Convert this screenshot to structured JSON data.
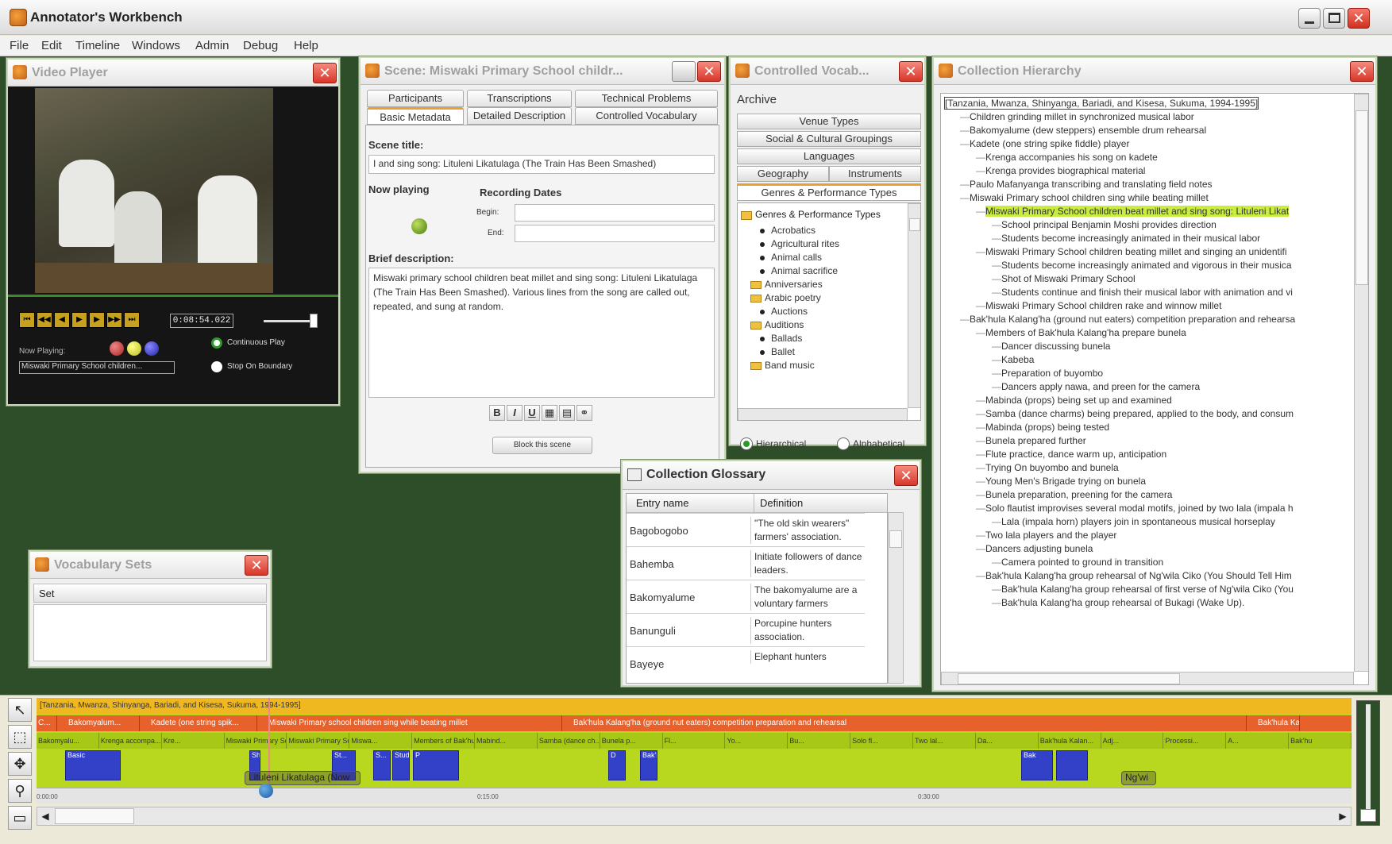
{
  "window": {
    "title": "Annotator's Workbench"
  },
  "menu": [
    "File",
    "Edit",
    "Timeline",
    "Windows",
    "Admin",
    "Debug",
    "Help"
  ],
  "video_player": {
    "title": "Video Player",
    "timecode": "0:08:54.022",
    "now_playing_label": "Now Playing:",
    "now_playing_value": "Miswaki Primary School children...",
    "continuous_play": "Continuous Play",
    "stop_on_boundary": "Stop On Boundary"
  },
  "scene": {
    "title": "Scene:  Miswaki Primary School childr...",
    "tabs_row1": [
      "Participants",
      "Transcriptions",
      "Technical Problems"
    ],
    "tabs_row2": [
      "Basic Metadata",
      "Detailed Description",
      "Controlled Vocabulary"
    ],
    "scene_title_label": "Scene title:",
    "scene_title_value": "I and sing song: Lituleni Likatulaga (The Train Has Been Smashed)",
    "now_playing_label": "Now playing",
    "recording_dates_label": "Recording Dates",
    "begin_label": "Begin:",
    "end_label": "End:",
    "brief_description_label": "Brief description:",
    "brief_description_text": "Miswaki primary school children beat millet and sing song: Lituleni Likatulaga (The Train Has Been Smashed). Various lines from the song are called out, repeated, and sung at random.",
    "format_buttons": [
      "B",
      "I",
      "U"
    ],
    "block_button": "Block this scene"
  },
  "controlled_vocab": {
    "title": "Controlled Vocab...",
    "archive": "Archive",
    "buttons": [
      "Venue Types",
      "Social & Cultural Groupings",
      "Languages",
      "Geography",
      "Instruments",
      "Genres & Performance Types"
    ],
    "tree_root": "Genres & Performance Types",
    "tree_items": [
      {
        "label": "Acrobatics",
        "folder": false
      },
      {
        "label": "Agricultural rites",
        "folder": false
      },
      {
        "label": "Animal calls",
        "folder": false
      },
      {
        "label": "Animal sacrifice",
        "folder": false
      },
      {
        "label": "Anniversaries",
        "folder": true
      },
      {
        "label": "Arabic poetry",
        "folder": true
      },
      {
        "label": "Auctions",
        "folder": false
      },
      {
        "label": "Auditions",
        "folder": true
      },
      {
        "label": "Ballads",
        "folder": false
      },
      {
        "label": "Ballet",
        "folder": false
      },
      {
        "label": "Band music",
        "folder": true
      }
    ],
    "radio_hierarchical": "Hierarchical",
    "radio_alphabetical": "Alphabetical"
  },
  "collection_hierarchy": {
    "title": "Collection Hierarchy",
    "items": [
      {
        "indent": 0,
        "text": "[Tanzania, Mwanza, Shinyanga, Bariadi, and Kisesa, Sukuma, 1994-1995]",
        "hl": false
      },
      {
        "indent": 1,
        "text": "Children grinding millet in synchronized musical labor",
        "hl": false
      },
      {
        "indent": 1,
        "text": "Bakomyalume (dew steppers) ensemble drum rehearsal",
        "hl": false
      },
      {
        "indent": 1,
        "text": "Kadete (one string spike fiddle) player",
        "hl": false
      },
      {
        "indent": 2,
        "text": "Krenga accompanies his song on kadete",
        "hl": false
      },
      {
        "indent": 2,
        "text": "Krenga provides biographical material",
        "hl": false
      },
      {
        "indent": 1,
        "text": "Paulo Mafanyanga transcribing and translating field notes",
        "hl": false
      },
      {
        "indent": 1,
        "text": "Miswaki Primary school children sing while beating millet",
        "hl": false
      },
      {
        "indent": 2,
        "text": "Miswaki Primary School children beat millet and sing song: Lituleni Likat",
        "hl": true
      },
      {
        "indent": 3,
        "text": "School principal Benjamin Moshi provides direction",
        "hl": false
      },
      {
        "indent": 3,
        "text": "Students become increasingly animated in their musical labor",
        "hl": false
      },
      {
        "indent": 2,
        "text": "Miswaki Primary School children beating millet and singing an unidentifi",
        "hl": false
      },
      {
        "indent": 3,
        "text": "Students become increasingly animated and vigorous in their musica",
        "hl": false
      },
      {
        "indent": 3,
        "text": "Shot of Miswaki Primary School",
        "hl": false
      },
      {
        "indent": 3,
        "text": "Students continue and finish their musical labor with animation and vi",
        "hl": false
      },
      {
        "indent": 2,
        "text": "Miswaki Primary School children rake and winnow millet",
        "hl": false
      },
      {
        "indent": 1,
        "text": "Bak'hula Kalang'ha (ground nut eaters) competition preparation and rehearsa",
        "hl": false
      },
      {
        "indent": 2,
        "text": "Members of Bak'hula Kalang'ha prepare bunela",
        "hl": false
      },
      {
        "indent": 3,
        "text": "Dancer discussing bunela",
        "hl": false
      },
      {
        "indent": 3,
        "text": "Kabeba",
        "hl": false
      },
      {
        "indent": 3,
        "text": "Preparation of buyombo",
        "hl": false
      },
      {
        "indent": 3,
        "text": "Dancers apply nawa, and preen for the camera",
        "hl": false
      },
      {
        "indent": 2,
        "text": "Mabinda (props) being set up and examined",
        "hl": false
      },
      {
        "indent": 2,
        "text": "Samba (dance charms) being prepared, applied to the body, and consum",
        "hl": false
      },
      {
        "indent": 2,
        "text": "Mabinda (props) being tested",
        "hl": false
      },
      {
        "indent": 2,
        "text": "Bunela prepared further",
        "hl": false
      },
      {
        "indent": 2,
        "text": "Flute practice, dance warm up, anticipation",
        "hl": false
      },
      {
        "indent": 2,
        "text": "Trying On buyombo and bunela",
        "hl": false
      },
      {
        "indent": 2,
        "text": "Young Men's Brigade trying on bunela",
        "hl": false
      },
      {
        "indent": 2,
        "text": "Bunela preparation, preening for the camera",
        "hl": false
      },
      {
        "indent": 2,
        "text": "Solo flautist improvises several modal motifs, joined by two lala (impala h",
        "hl": false
      },
      {
        "indent": 3,
        "text": "Lala (impala horn) players join in spontaneous musical horseplay",
        "hl": false
      },
      {
        "indent": 2,
        "text": "Two lala players and the player",
        "hl": false
      },
      {
        "indent": 2,
        "text": "Dancers adjusting bunela",
        "hl": false
      },
      {
        "indent": 3,
        "text": "Camera pointed to ground in transition",
        "hl": false
      },
      {
        "indent": 2,
        "text": "Bak'hula Kalang'ha group rehearsal of Ng'wila Ciko (You Should Tell Him",
        "hl": false
      },
      {
        "indent": 3,
        "text": "Bak'hula Kalang'ha group rehearsal of first verse of Ng'wila Ciko (You",
        "hl": false
      },
      {
        "indent": 3,
        "text": "Bak'hula Kalang'ha group rehearsal of Bukagi (Wake Up).",
        "hl": false
      }
    ]
  },
  "glossary": {
    "title": "Collection Glossary",
    "col_name": "Entry name",
    "col_def": "Definition",
    "rows": [
      {
        "name": "Bagobogobo",
        "def": "\"The old skin wearers\" farmers' association."
      },
      {
        "name": "Bahemba",
        "def": "Initiate followers of dance leaders."
      },
      {
        "name": "Bakomyalume",
        "def": "The bakomyalume are a voluntary farmers"
      },
      {
        "name": "Banunguli",
        "def": "Porcupine hunters association."
      },
      {
        "name": "Bayeye",
        "def": "Elephant hunters"
      }
    ]
  },
  "vocab_sets": {
    "title": "Vocabulary Sets",
    "header": "Set"
  },
  "timeline": {
    "row1": "[Tanzania, Mwanza, Shinyanga, Bariadi, and Kisesa, Sukuma, 1994-1995]",
    "row2": [
      {
        "t": "C...",
        "w": 26
      },
      {
        "t": "Bakomyalum...",
        "w": 92
      },
      {
        "t": "Kadete (one string spik...",
        "w": 136
      },
      {
        "t": "Miswaki Primary school children sing while beating millet",
        "w": 372
      },
      {
        "t": "Bak'hula Kalang'ha (ground nut eaters) competition preparation and rehearsal",
        "w": 850
      },
      {
        "t": "Bak'hula Kala",
        "w": 55
      }
    ],
    "row3": [
      "Bakomyalu...",
      "Krenga accompa...",
      "Kre...",
      "Miswaki Primary School child...",
      "Miswaki Primary Schoo...",
      "Miswa...",
      "Members of Bak'hula Kalang'ha prepa...",
      "Mabind...",
      "Samba (dance ch...",
      "Bunela p...",
      "Fl...",
      "Yo...",
      "Bu...",
      "Solo fl...",
      "Two lal...",
      "Da...",
      "Bak'hula Kalan...",
      "Adj...",
      "Processi...",
      "A...",
      "Bak'hu"
    ],
    "blue_labels": [
      "Basic",
      "Sh...",
      "St...",
      "S...",
      "Students",
      "P",
      "D",
      "Bak'hul...",
      "Bak"
    ],
    "cursor_tag": "Lituleni Likatulaga (Now",
    "right_tag": "Ng'wi",
    "ticks": [
      "0:00:00",
      "0:15:00",
      "0:30:00"
    ]
  }
}
